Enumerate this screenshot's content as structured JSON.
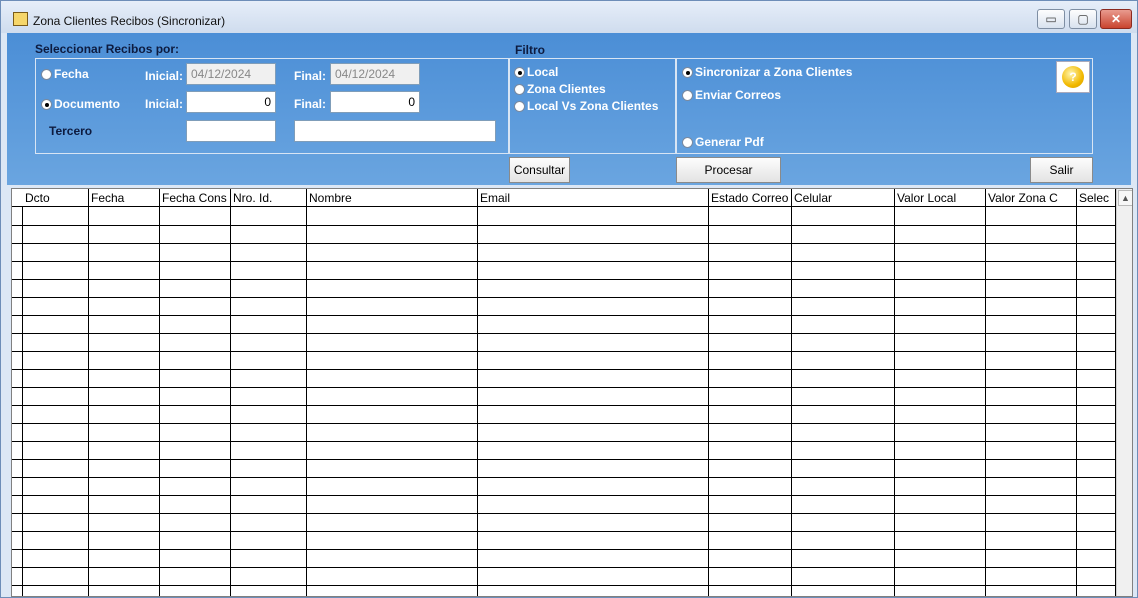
{
  "window": {
    "title": "Zona Clientes Recibos (Sincronizar)",
    "controls": {
      "minimize": "▭",
      "maximize": "▢",
      "close": "✕"
    }
  },
  "select_section": {
    "heading": "Seleccionar Recibos por:",
    "fecha_label": "Fecha",
    "fecha_selected": false,
    "inicial_label": "Inicial:",
    "final_label": "Final:",
    "fecha_inicial_value": "04/12/2024",
    "fecha_final_value": "04/12/2024",
    "documento_label": "Documento",
    "documento_selected": true,
    "doc_inicial_value": "0",
    "doc_final_value": "0",
    "tercero_label": "Tercero",
    "tercero_code_value": "",
    "tercero_name_value": ""
  },
  "filtro_section": {
    "heading": "Filtro",
    "options": [
      {
        "label": "Local",
        "selected": true
      },
      {
        "label": "Zona Clientes",
        "selected": false
      },
      {
        "label": "Local Vs Zona Clientes",
        "selected": false
      }
    ]
  },
  "action_section": {
    "options": [
      {
        "label": "Sincronizar a Zona Clientes",
        "selected": true
      },
      {
        "label": "Enviar Correos",
        "selected": false
      },
      {
        "label": "Generar Pdf",
        "selected": false
      }
    ],
    "help_icon": "?"
  },
  "buttons": {
    "consultar": "Consultar",
    "procesar": "Procesar",
    "salir": "Salir"
  },
  "grid": {
    "columns": [
      "Dcto",
      "Fecha",
      "Fecha Cons",
      "Nro. Id.",
      "Nombre",
      "Email",
      "Estado Correo",
      "Celular",
      "Valor Local",
      "Valor Zona C",
      "Selec"
    ],
    "scroll_up": "▲"
  }
}
